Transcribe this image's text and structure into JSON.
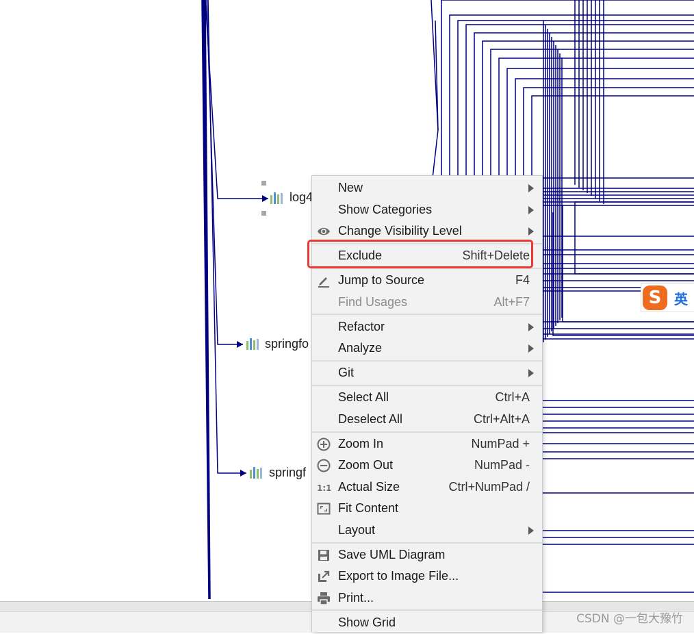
{
  "diagram": {
    "nodes": [
      {
        "label": "log4"
      },
      {
        "label": "springfo"
      },
      {
        "label": "springf"
      }
    ],
    "line_color": "#000080",
    "node_icon": "module-bars-icon"
  },
  "context_menu": {
    "items": [
      {
        "label": "New",
        "submenu": true
      },
      {
        "label": "Show Categories",
        "submenu": true
      },
      {
        "label": "Change Visibility Level",
        "submenu": true,
        "icon": "eye-icon"
      },
      {
        "label": "Exclude",
        "shortcut": "Shift+Delete",
        "highlighted": true
      },
      {
        "label": "Jump to Source",
        "shortcut": "F4",
        "icon": "pencil-icon"
      },
      {
        "label": "Find Usages",
        "shortcut": "Alt+F7",
        "disabled": true
      },
      {
        "label": "Refactor",
        "submenu": true
      },
      {
        "label": "Analyze",
        "submenu": true
      },
      {
        "label": "Git",
        "submenu": true
      },
      {
        "label": "Select All",
        "shortcut": "Ctrl+A"
      },
      {
        "label": "Deselect All",
        "shortcut": "Ctrl+Alt+A"
      },
      {
        "label": "Zoom In",
        "shortcut": "NumPad +",
        "icon": "zoom-in-icon"
      },
      {
        "label": "Zoom Out",
        "shortcut": "NumPad -",
        "icon": "zoom-out-icon"
      },
      {
        "label": "Actual Size",
        "shortcut": "Ctrl+NumPad /",
        "icon": "actual-size-icon"
      },
      {
        "label": "Fit Content",
        "icon": "fit-content-icon"
      },
      {
        "label": "Layout",
        "submenu": true
      },
      {
        "label": "Save UML Diagram",
        "icon": "save-icon"
      },
      {
        "label": "Export to Image File...",
        "icon": "export-icon"
      },
      {
        "label": "Print...",
        "icon": "print-icon"
      },
      {
        "label": "Show Grid"
      }
    ]
  },
  "ime": {
    "logo": "S",
    "lang": "英"
  },
  "watermark": "CSDN @一包大豫竹",
  "colors": {
    "highlight_border": "#e83a32",
    "menu_bg": "#f2f2f2",
    "ime_orange": "#ef6b1f",
    "ime_blue": "#1d6fe0"
  }
}
